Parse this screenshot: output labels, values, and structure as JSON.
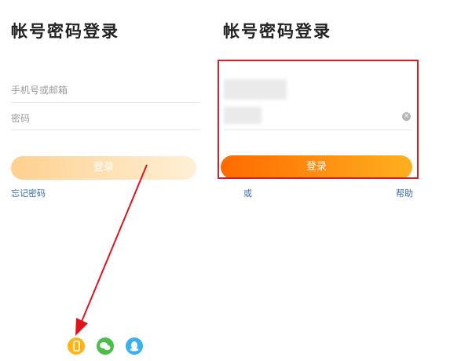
{
  "left": {
    "title": "帐号密码登录",
    "account_placeholder": "手机号或邮箱",
    "password_placeholder": "密码",
    "login_label": "登录",
    "forgot_label": "忘记密码"
  },
  "right": {
    "title": "帐号密码登录",
    "login_label": "登录",
    "bottom_left_text": "或",
    "help_label": "帮助"
  },
  "icons": {
    "phone": "phone-icon",
    "wechat": "wechat-icon",
    "qq": "qq-icon",
    "clear": "clear-icon"
  },
  "colors": {
    "accent": "#ff9500",
    "highlight": "#d0202a",
    "link": "#3a6ea5"
  }
}
